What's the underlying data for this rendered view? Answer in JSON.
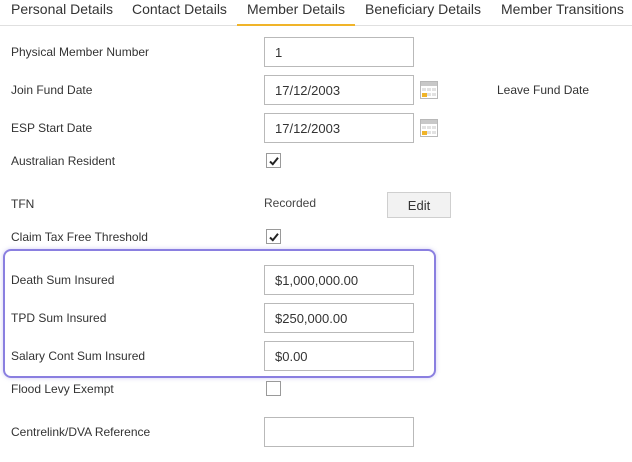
{
  "tabs": [
    {
      "label": "Personal Details"
    },
    {
      "label": "Contact Details"
    },
    {
      "label": "Member Details",
      "active": true
    },
    {
      "label": "Beneficiary Details"
    },
    {
      "label": "Member Transitions"
    }
  ],
  "form": {
    "physical_member_number": {
      "label": "Physical Member Number",
      "value": "1"
    },
    "join_fund_date": {
      "label": "Join Fund Date",
      "value": "17/12/2003"
    },
    "leave_fund_date": {
      "label": "Leave Fund Date"
    },
    "esp_start_date": {
      "label": "ESP Start Date",
      "value": "17/12/2003"
    },
    "australian_resident": {
      "label": "Australian Resident",
      "checked": true
    },
    "tfn": {
      "label": "TFN",
      "status": "Recorded",
      "edit_label": "Edit"
    },
    "claim_tax_free_threshold": {
      "label": "Claim Tax Free Threshold",
      "checked": true
    },
    "death_sum_insured": {
      "label": "Death Sum Insured",
      "value": "$1,000,000.00"
    },
    "tpd_sum_insured": {
      "label": "TPD Sum Insured",
      "value": "$250,000.00"
    },
    "salary_cont_sum_insured": {
      "label": "Salary Cont Sum Insured",
      "value": "$0.00"
    },
    "flood_levy_exempt": {
      "label": "Flood Levy Exempt",
      "checked": false
    },
    "centrelink_dva_reference": {
      "label": "Centrelink/DVA Reference",
      "value": ""
    }
  },
  "icons": {
    "calendar": "calendar-icon",
    "check": "check-icon"
  },
  "colors": {
    "accent": "#f0b429",
    "highlight": "#8a7fe0"
  }
}
